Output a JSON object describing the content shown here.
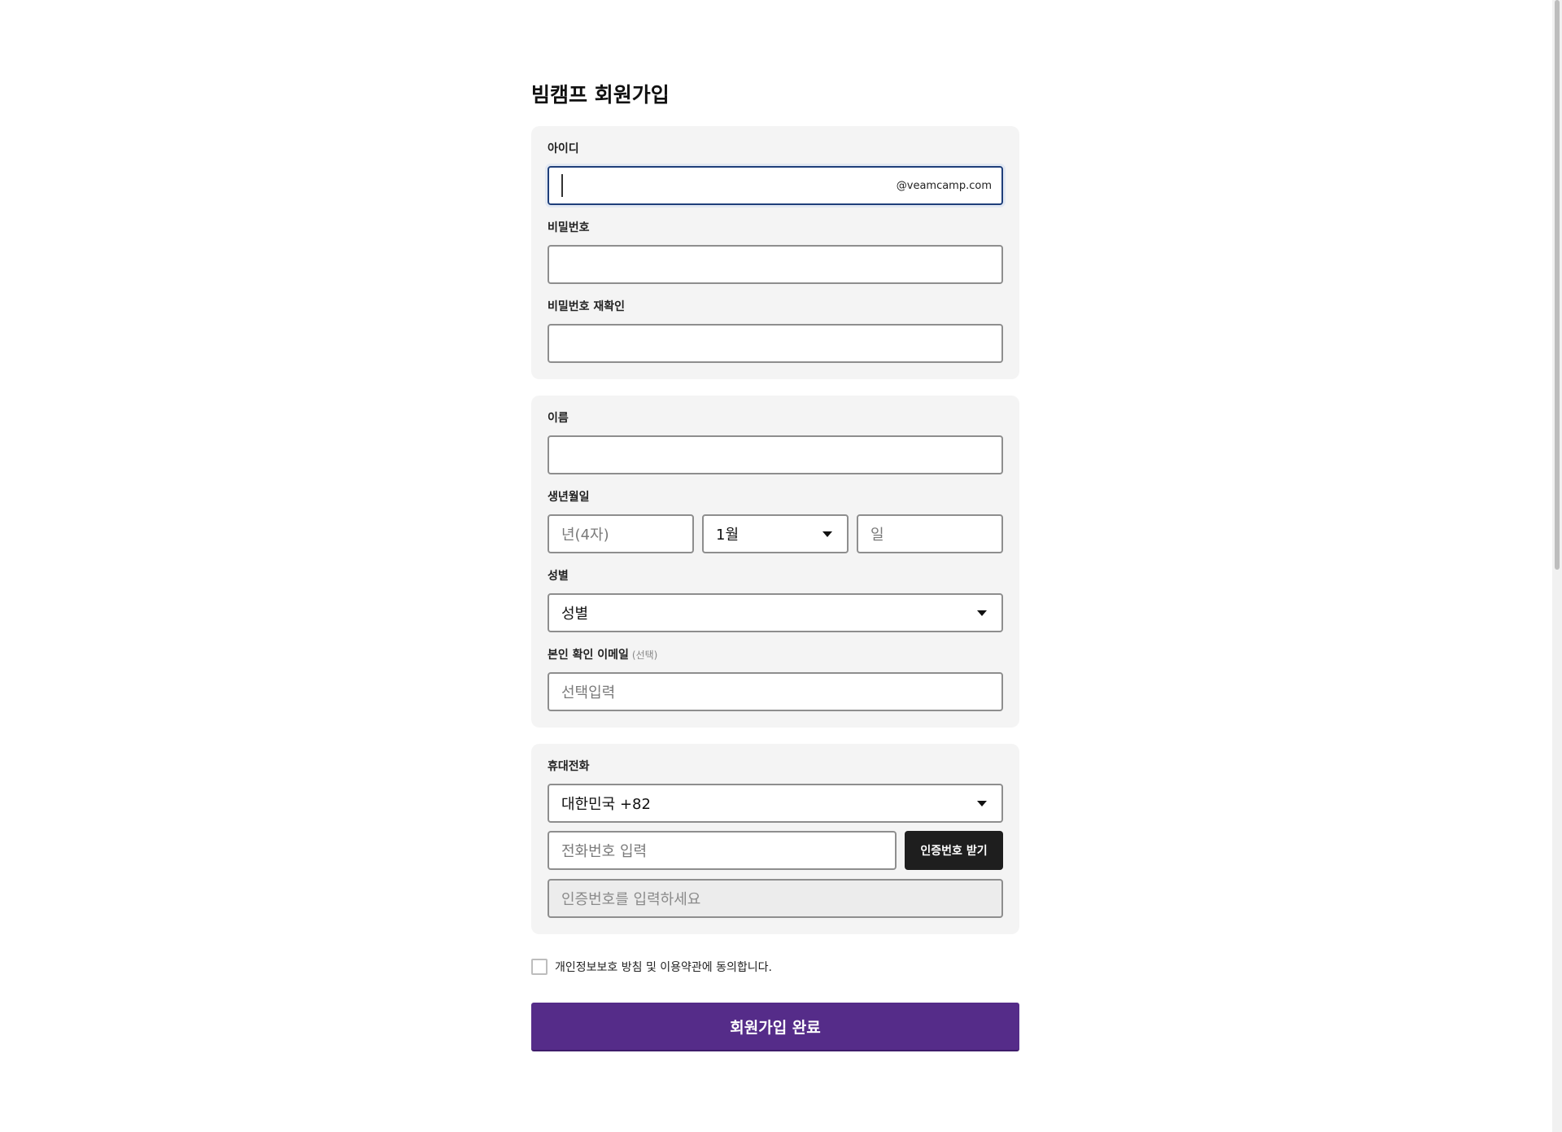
{
  "page": {
    "title": "빔캠프 회원가입"
  },
  "account": {
    "id_label": "아이디",
    "id_suffix": "@veamcamp.com",
    "password_label": "비밀번호",
    "password_confirm_label": "비밀번호 재확인"
  },
  "profile": {
    "name_label": "이름",
    "birth_label": "생년월일",
    "birth_year_placeholder": "년(4자)",
    "birth_month_value": "1월",
    "birth_day_placeholder": "일",
    "gender_label": "성별",
    "gender_value": "성별",
    "email_label": "본인 확인 이메일",
    "email_optional": "(선택)",
    "email_placeholder": "선택입력"
  },
  "phone": {
    "label": "휴대전화",
    "country_value": "대한민국 +82",
    "number_placeholder": "전화번호 입력",
    "get_code_button": "인증번호 받기",
    "code_placeholder": "인증번호를 입력하세요"
  },
  "terms": {
    "agree_text": "개인정보보호 방침 및 이용약관에 동의합니다."
  },
  "submit": {
    "label": "회원가입 완료"
  },
  "colors": {
    "primary": "#552c89",
    "dark_button": "#1e1e1e",
    "card_bg": "#f4f4f4",
    "focus_border": "#1f3f7a"
  }
}
